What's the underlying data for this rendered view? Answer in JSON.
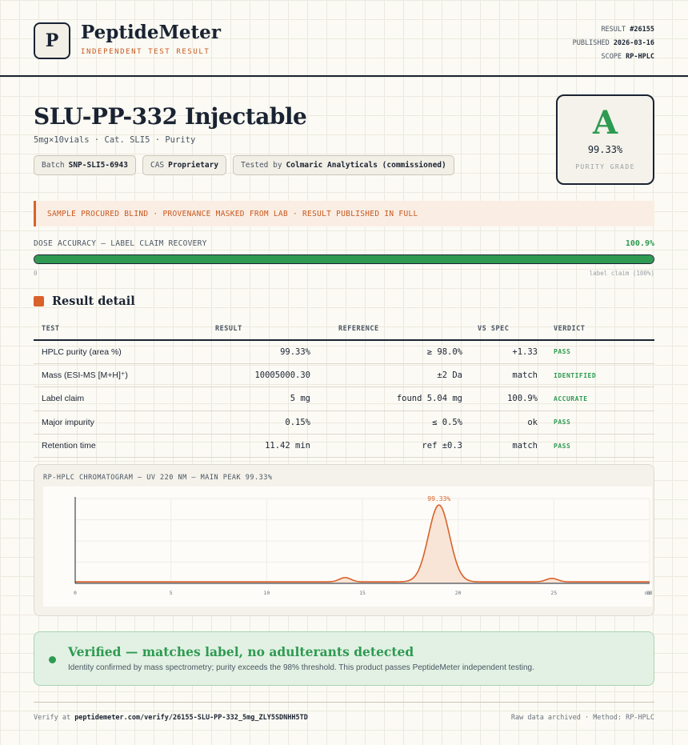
{
  "brand": {
    "logo_letter": "P",
    "name": "PeptideMeter",
    "tagline": "INDEPENDENT TEST RESULT"
  },
  "meta": {
    "result_label": "RESULT",
    "result_value": "#26155",
    "published_label": "PUBLISHED",
    "published_value": "2026-03-16",
    "scope_label": "SCOPE",
    "scope_value": "RP-HPLC"
  },
  "product": {
    "title": "SLU-PP-332 Injectable",
    "subtitle": "5mg×10vials · Cat. SLI5 · Purity",
    "chips": [
      {
        "label": "Batch",
        "value": "SNP-SLI5-6943"
      },
      {
        "label": "CAS",
        "value": "Proprietary"
      },
      {
        "label": "Tested by",
        "value": "Colmaric Analyticals (commissioned)"
      }
    ]
  },
  "grade": {
    "letter": "A",
    "value": "99.33%",
    "label": "PURITY GRADE"
  },
  "notice": "SAMPLE PROCURED BLIND · PROVENANCE MASKED FROM LAB · RESULT PUBLISHED IN FULL",
  "dose": {
    "label": "DOSE ACCURACY — LABEL CLAIM RECOVERY",
    "value": "100.9%",
    "fill_fraction": 1.0,
    "min_label": "0",
    "max_label": "label claim (100%)"
  },
  "section_title": "Result detail",
  "table": {
    "headers": [
      "TEST",
      "RESULT",
      "REFERENCE",
      "VS SPEC",
      "VERDICT"
    ],
    "rows": [
      {
        "test": "HPLC purity (area %)",
        "result": "99.33%",
        "reference": "≥ 98.0%",
        "vs_spec": "+1.33",
        "verdict": "PASS"
      },
      {
        "test": "Mass (ESI-MS [M+H]⁺)",
        "result": "10005000.30",
        "reference": "±2 Da",
        "vs_spec": "match",
        "verdict": "IDENTIFIED"
      },
      {
        "test": "Label claim",
        "result": "5 mg",
        "reference": "found 5.04 mg",
        "vs_spec": "100.9%",
        "verdict": "ACCURATE"
      },
      {
        "test": "Major impurity",
        "result": "0.15%",
        "reference": "≤ 0.5%",
        "vs_spec": "ok",
        "verdict": "PASS"
      },
      {
        "test": "Retention time",
        "result": "11.42 min",
        "reference": "ref ±0.3",
        "vs_spec": "match",
        "verdict": "PASS"
      }
    ]
  },
  "chart_data": {
    "type": "line",
    "title": "RP-HPLC CHROMATOGRAM — UV 220 NM — MAIN PEAK 99.33%",
    "xlabel": "",
    "ylabel": "",
    "xlim": [
      0,
      30
    ],
    "x_ticks": [
      "0",
      "5",
      "10",
      "15",
      "20",
      "25",
      "30"
    ],
    "x_end_unit": "min",
    "peaks": [
      {
        "rt": 14.1,
        "height": 0.055,
        "width": 0.3
      },
      {
        "rt": 19.0,
        "height": 1.0,
        "width": 0.55,
        "label": "99.33%"
      },
      {
        "rt": 24.9,
        "height": 0.045,
        "width": 0.3
      }
    ],
    "baseline": 0.02,
    "color": "#d9622a",
    "fill": "#f8e5d7",
    "grid": true
  },
  "verified": {
    "title": "Verified — matches label, no adulterants detected",
    "text": "Identity confirmed by mass spectrometry; purity exceeds the 98% threshold. This product passes PeptideMeter independent testing."
  },
  "footer": {
    "verify_prefix": "Verify at",
    "verify_url": "peptidemeter.com/verify/26155-SLU-PP-332_5mg_ZLY5SDNHH5TD",
    "right_text": "Raw data archived · Method: RP-HPLC"
  }
}
